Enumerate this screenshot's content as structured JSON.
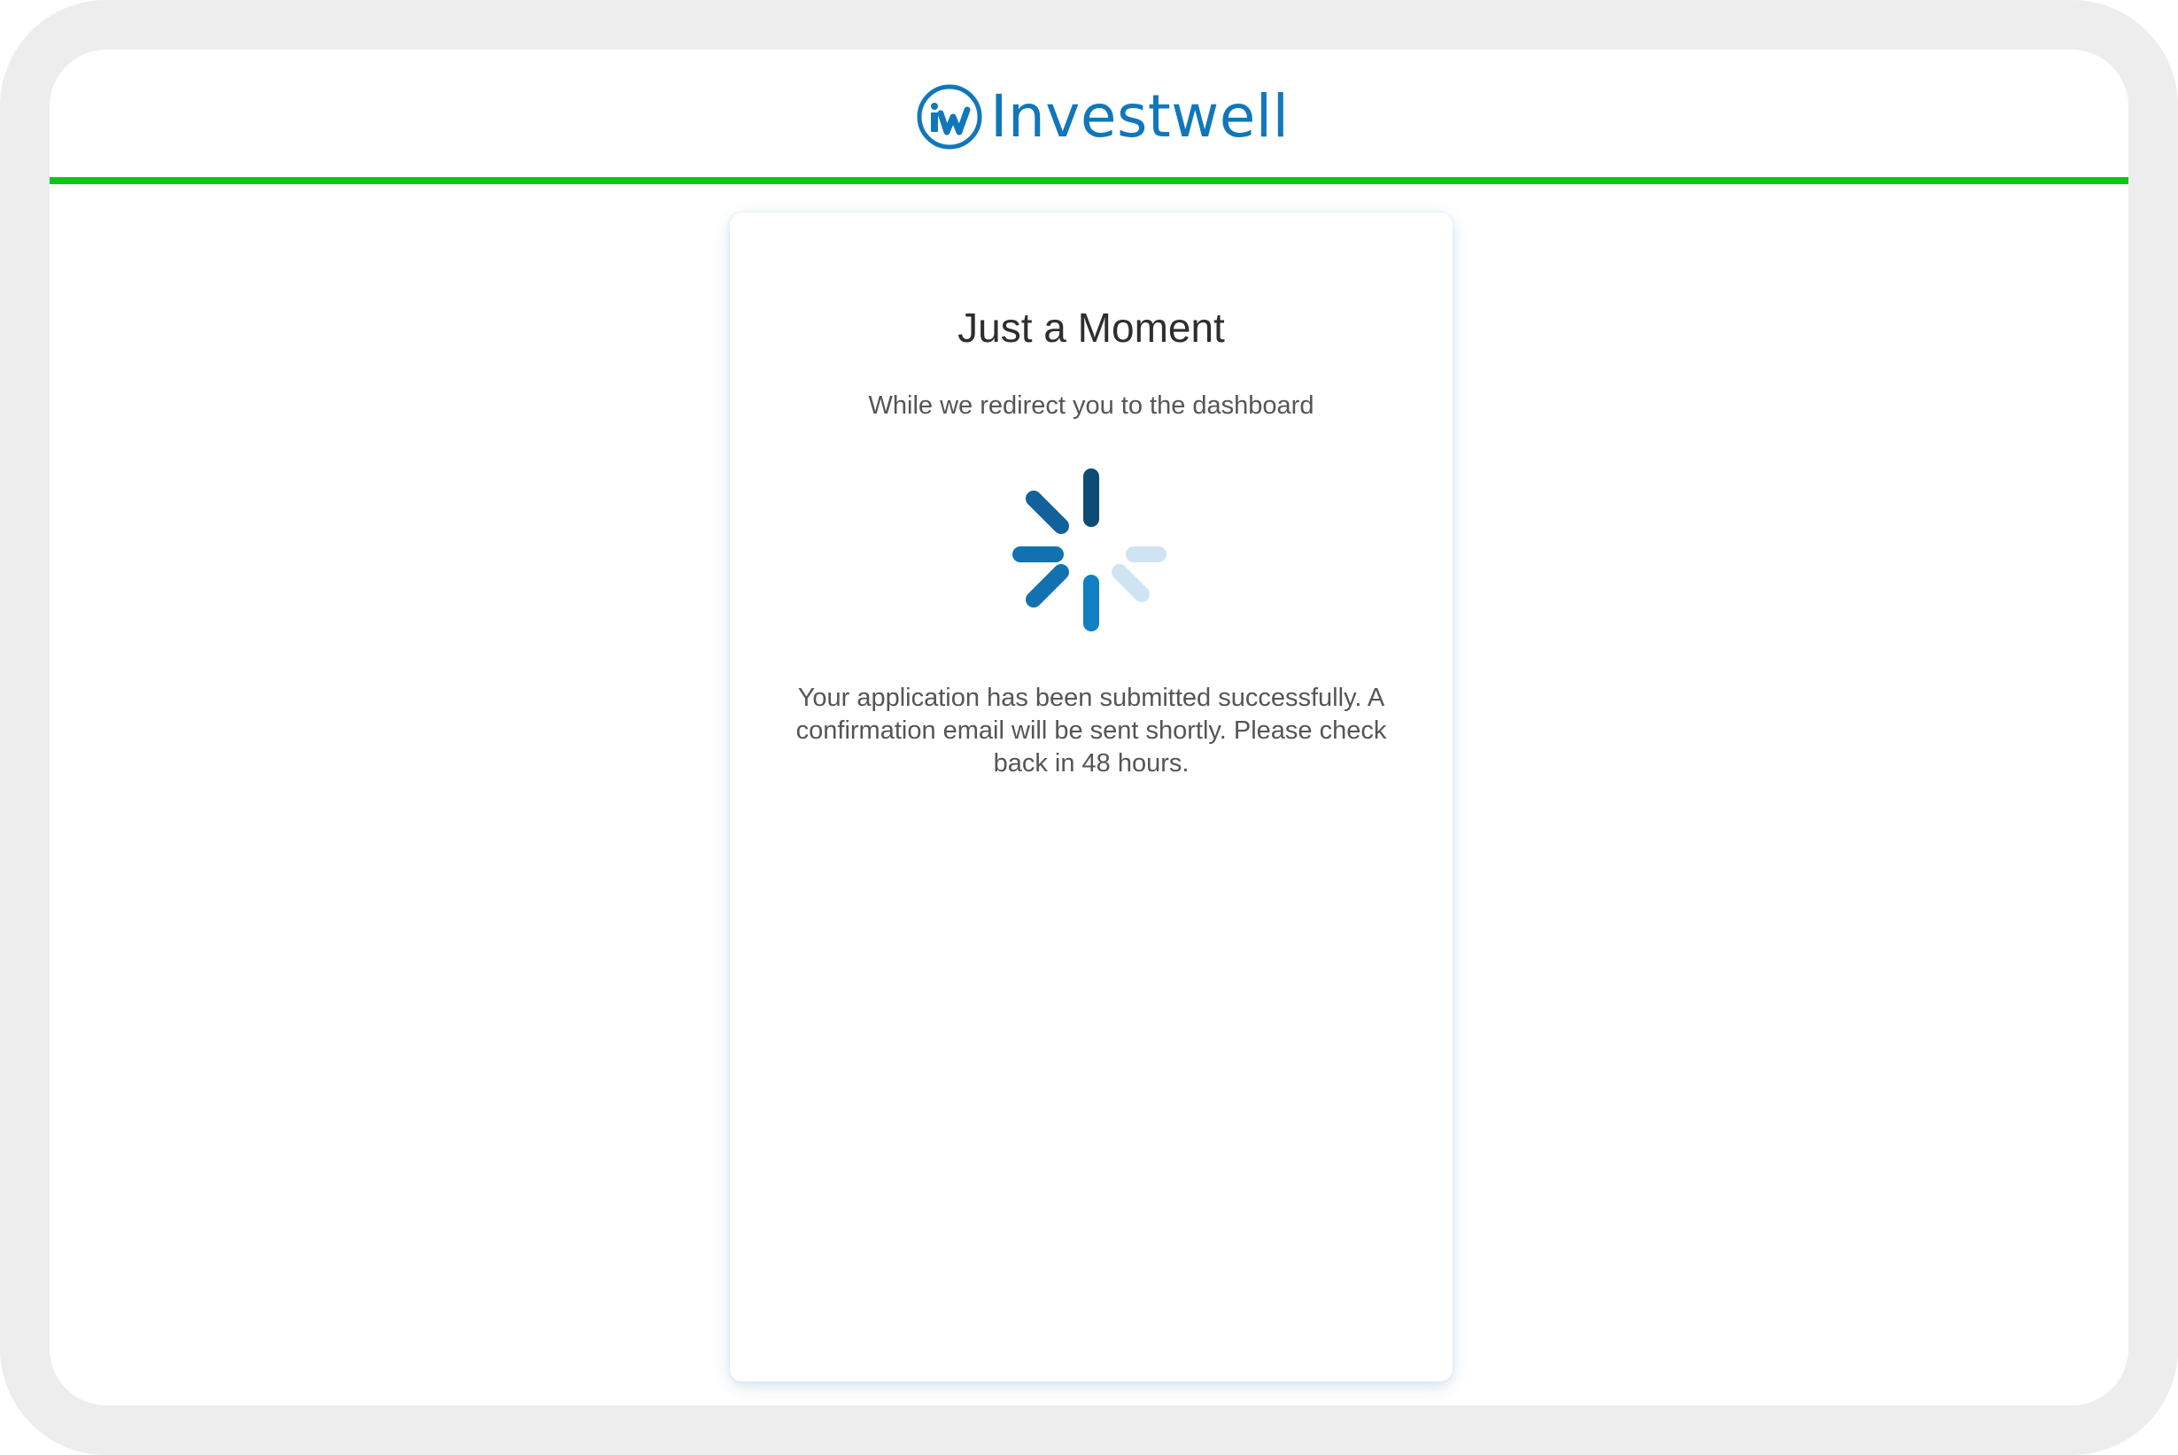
{
  "brand": {
    "name": "Investwell",
    "logo_initials": "iw",
    "color": "#1177ba"
  },
  "header": {
    "accent_color": "#11c41a"
  },
  "loading_card": {
    "title": "Just a Moment",
    "subtitle": "While we redirect you to the dashboard",
    "spinner_icon": "loading-spinner-icon",
    "message": "Your application has been submitted successfully. A confirmation email will be sent shortly. Please check back in 48 hours."
  }
}
